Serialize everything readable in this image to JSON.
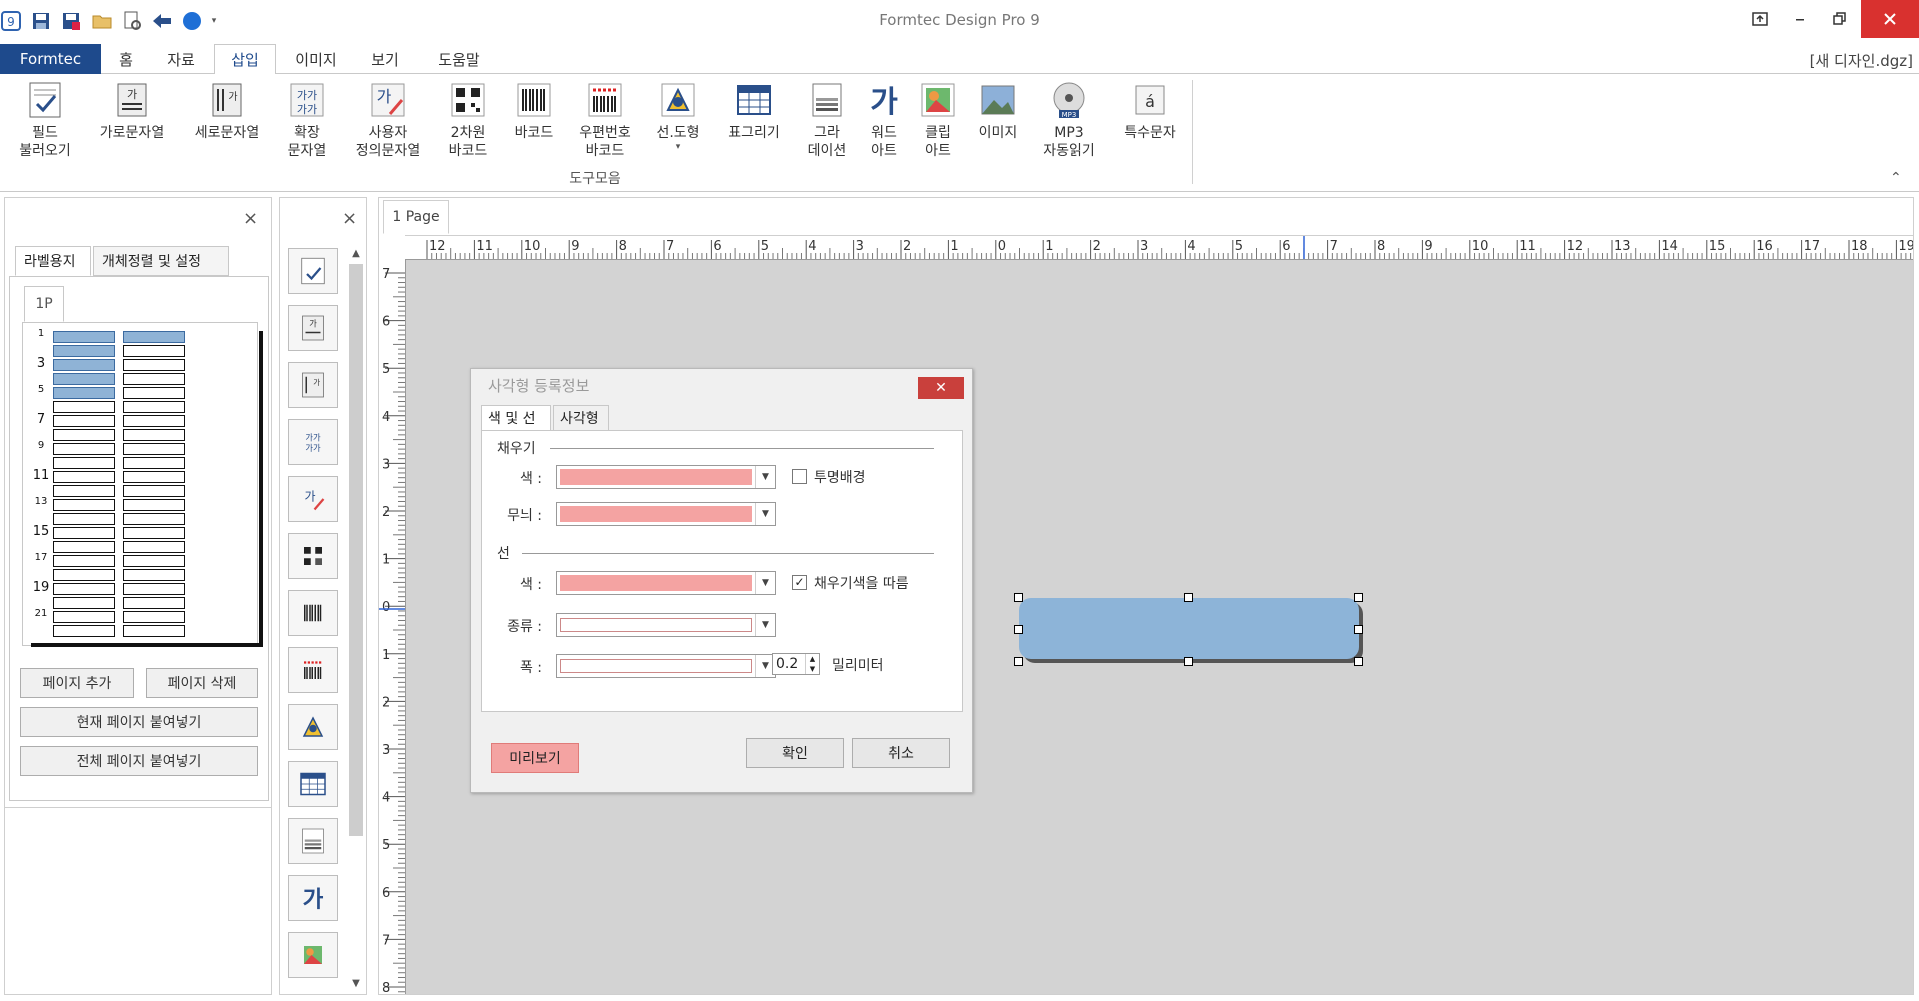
{
  "window": {
    "title": "Formtec Design Pro 9",
    "document_name": "[새 디자인.dgz]"
  },
  "quick_access": [
    "app-icon",
    "save-icon",
    "save-all-icon",
    "open-folder-icon",
    "print-preview-icon",
    "back-arrow-icon",
    "circle-icon",
    "dropdown-icon"
  ],
  "menu_tabs": [
    {
      "label": "Formtec"
    },
    {
      "label": "홈"
    },
    {
      "label": "자료"
    },
    {
      "label": "삽입"
    },
    {
      "label": "이미지"
    },
    {
      "label": "보기"
    },
    {
      "label": "도움말"
    }
  ],
  "ribbon": {
    "group_label": "도구모음",
    "buttons": [
      {
        "label": "필드\n불러오기"
      },
      {
        "label": "가로문자열"
      },
      {
        "label": "세로문자열"
      },
      {
        "label": "확장\n문자열"
      },
      {
        "label": "사용자\n정의문자열"
      },
      {
        "label": "2차원\n바코드"
      },
      {
        "label": "바코드"
      },
      {
        "label": "우편번호\n바코드"
      },
      {
        "label": "선.도형"
      },
      {
        "label": "표그리기"
      },
      {
        "label": "그라\n데이션"
      },
      {
        "label": "워드\n아트"
      },
      {
        "label": "클립\n아트"
      },
      {
        "label": "이미지"
      },
      {
        "label": "MP3\n자동읽기"
      },
      {
        "label": "특수문자"
      }
    ]
  },
  "left_panel": {
    "tabs": [
      "라벨용지",
      "개체정렬 및 설정"
    ],
    "page_tab": "1P",
    "row_numbers": [
      "1",
      "3",
      "5",
      "7",
      "9",
      "11",
      "13",
      "15",
      "17",
      "19",
      "21"
    ],
    "buttons": {
      "add_page": "페이지 추가",
      "delete_page": "페이지 삭제",
      "paste_current": "현재 페이지 붙여넣기",
      "paste_all": "전체 페이지 붙여넣기"
    },
    "close": "×"
  },
  "toolbox": {
    "close": "×"
  },
  "canvas": {
    "page_tab": "1 Page",
    "hruler_labels": [
      "12",
      "11",
      "10",
      "9",
      "8",
      "7",
      "6",
      "5",
      "4",
      "3",
      "2",
      "1",
      "0",
      "1",
      "2",
      "3",
      "4",
      "5",
      "6",
      "7",
      "8",
      "9",
      "10",
      "11",
      "12",
      "13",
      "14",
      "15",
      "16",
      "17",
      "18",
      "19"
    ],
    "vruler_labels": [
      "7",
      "6",
      "5",
      "4",
      "3",
      "2",
      "1",
      "0",
      "1",
      "2",
      "3",
      "4",
      "5",
      "6",
      "7",
      "8"
    ]
  },
  "dialog": {
    "title": "사각형 등록정보",
    "close": "✕",
    "tabs": [
      "색 및 선",
      "사각형"
    ],
    "fill_section": "채우기",
    "line_section": "선",
    "fill_color_label": "색 :",
    "pattern_label": "무늬 :",
    "transparent_label": "투명배경",
    "transparent_checked": false,
    "line_color_label": "색 :",
    "follow_fill_label": "채우기색을 따름",
    "follow_fill_checked": true,
    "type_label": "종류 :",
    "width_label": "폭 :",
    "width_value": "0.2",
    "unit_label": "밀리미터",
    "preview_button": "미리보기",
    "ok_button": "확인",
    "cancel_button": "취소",
    "fill_color": "#f4a3a2",
    "line_color": "#f4a3a2"
  },
  "shape": {
    "fill_color": "#8db4d8"
  },
  "colors": {
    "accent": "#1e4a8c",
    "close_red": "#d9312f"
  }
}
